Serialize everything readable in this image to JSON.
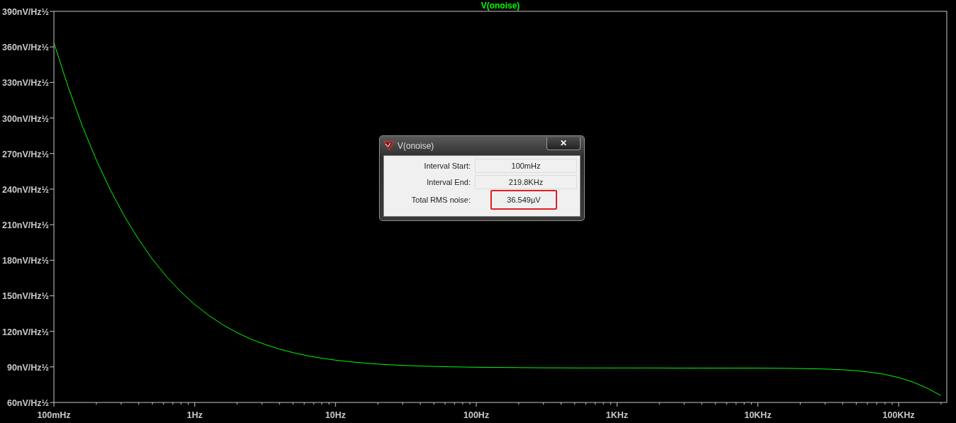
{
  "plot": {
    "chart_data": {
      "type": "line",
      "categories": [
        "100mHz",
        null,
        null,
        null,
        null,
        null,
        null,
        null,
        null,
        null,
        "1Hz",
        null,
        null,
        null,
        null,
        null,
        null,
        null,
        null,
        null,
        "10Hz",
        null,
        null,
        null,
        null,
        null,
        null,
        null,
        null,
        null,
        "100Hz",
        null,
        null,
        null,
        null,
        null,
        null,
        null,
        null,
        null,
        "1KHz",
        null,
        null,
        null,
        null,
        null,
        null,
        null,
        null,
        null,
        "10KHz",
        null,
        null,
        null,
        null,
        null,
        null,
        null,
        null,
        null,
        "100KHz",
        null,
        null,
        null
      ],
      "series": [
        {
          "name": "V(onoise)",
          "color": "#00ff00",
          "values": [
            363.5,
            326.5,
            293.7,
            264.9,
            239.5,
            217.3,
            197.8,
            180.8,
            166.2,
            153.5,
            142.6,
            133.4,
            125.5,
            118.9,
            113.4,
            108.9,
            105.1,
            102.0,
            99.4,
            97.4,
            95.7,
            94.4,
            93.3,
            92.4,
            91.7,
            91.2,
            90.7,
            90.4,
            90.1,
            89.9,
            89.7,
            89.6,
            89.5,
            89.4,
            89.3,
            89.2,
            89.2,
            89.1,
            89.1,
            89.1,
            89.1,
            89.1,
            89.1,
            89.1,
            89.0,
            89.0,
            89.0,
            89.0,
            89.0,
            89.0,
            89.0,
            88.9,
            88.8,
            88.6,
            88.4,
            88.1,
            87.6,
            86.8,
            85.5,
            83.7,
            81.0,
            77.3,
            72.2,
            65.9
          ]
        }
      ],
      "ylim": [
        60,
        390
      ],
      "yticks": [
        {
          "value": 390,
          "label": "390nV/Hz½"
        },
        {
          "value": 360,
          "label": "360nV/Hz½"
        },
        {
          "value": 330,
          "label": "330nV/Hz½"
        },
        {
          "value": 300,
          "label": "300nV/Hz½"
        },
        {
          "value": 270,
          "label": "270nV/Hz½"
        },
        {
          "value": 240,
          "label": "240nV/Hz½"
        },
        {
          "value": 210,
          "label": "210nV/Hz½"
        },
        {
          "value": 180,
          "label": "180nV/Hz½"
        },
        {
          "value": 150,
          "label": "150nV/Hz½"
        },
        {
          "value": 120,
          "label": "120nV/Hz½"
        },
        {
          "value": 90,
          "label": "90nV/Hz½"
        },
        {
          "value": 60,
          "label": "60nV/Hz½"
        }
      ]
    }
  },
  "dialog": {
    "title": "V(onoise)",
    "close": "✕",
    "rows": [
      {
        "label": "Interval Start:",
        "value": "100mHz",
        "highlighted": false
      },
      {
        "label": "Interval End:",
        "value": "219.8KHz",
        "highlighted": false
      },
      {
        "label": "Total RMS noise:",
        "value": "36.549µV",
        "highlighted": true
      }
    ]
  }
}
